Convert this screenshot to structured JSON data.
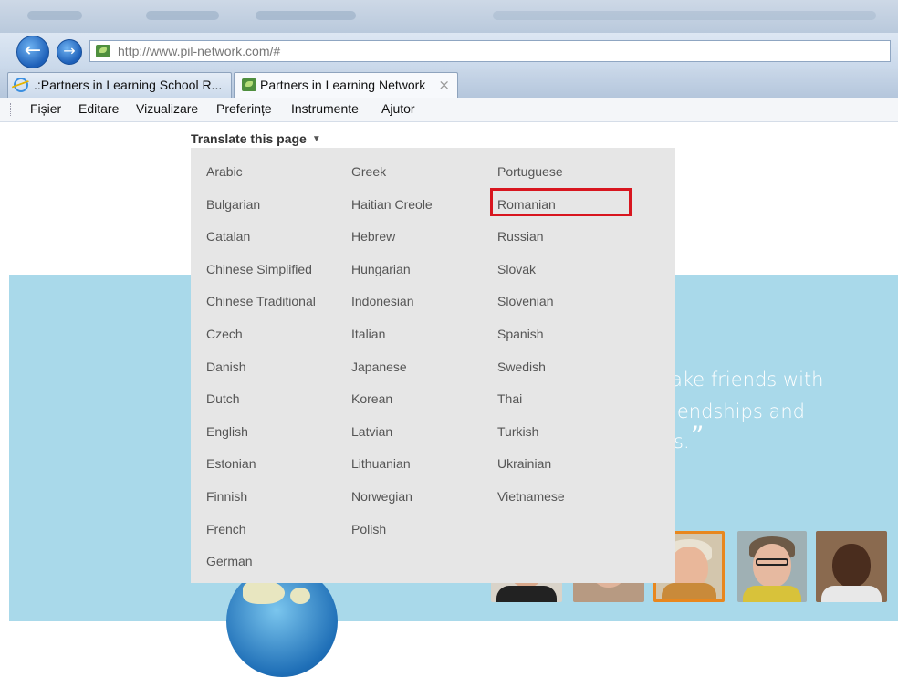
{
  "browser": {
    "url_host": "http://www.pil-network.com/",
    "url_hash": "#",
    "tabs": [
      {
        "label": ".:Partners in Learning School R..."
      },
      {
        "label": "Partners in Learning Network",
        "close": "×"
      }
    ],
    "menu": [
      "Fișier",
      "Editare",
      "Vizualizare",
      "Preferințe",
      "Instrumente",
      "Ajutor"
    ]
  },
  "translate": {
    "toggle_label": "Translate this page",
    "caret": "▼",
    "selected": "Romanian",
    "languages": [
      [
        "Arabic",
        "Bulgarian",
        "Catalan",
        "Chinese Simplified",
        "Chinese Traditional",
        "Czech",
        "Danish",
        "Dutch",
        "English",
        "Estonian",
        "Finnish",
        "French",
        "German"
      ],
      [
        "Greek",
        "Haitian Creole",
        "Hebrew",
        "Hungarian",
        "Indonesian",
        "Italian",
        "Japanese",
        "Korean",
        "Latvian",
        "Lithuanian",
        "Norwegian",
        "Polish"
      ],
      [
        "Portuguese",
        "Romanian",
        "Russian",
        "Slovak",
        "Slovenian",
        "Spanish",
        "Swedish",
        "Thai",
        "Turkish",
        "Ukrainian",
        "Vietnamese"
      ]
    ]
  },
  "hero": {
    "quote_lines": [
      "ake friends with",
      "friendships and",
      "s."
    ],
    "quote_mark": "”"
  },
  "colors": {
    "hero_bg": "#a9d9ea",
    "dropdown_bg": "#e6e6e6",
    "highlight": "#d8161f"
  }
}
